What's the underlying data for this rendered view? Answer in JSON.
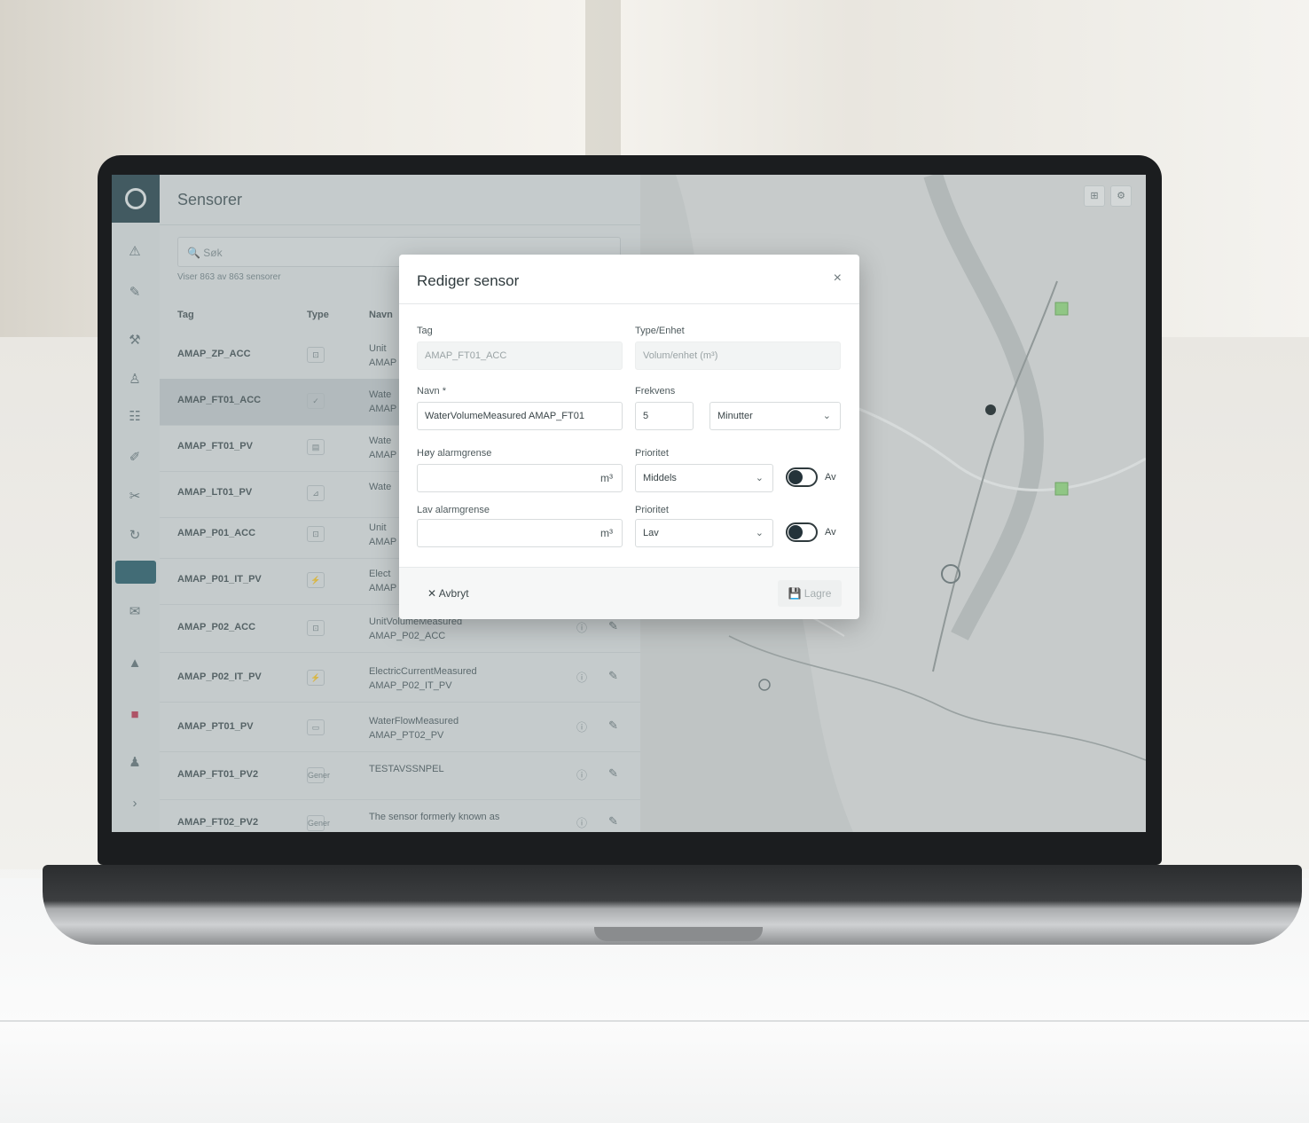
{
  "app": {
    "title": "Sensorer",
    "search_placeholder": "Søk",
    "count_text": "Viser 863 av 863 sensorer"
  },
  "table": {
    "headers": [
      "Tag",
      "Type",
      "Navn"
    ],
    "rows": [
      {
        "tag": "AMAP_ZP_ACC",
        "type": "⊡",
        "name": "Unit",
        "sub": "AMAP"
      },
      {
        "tag": "AMAP_FT01_ACC",
        "type": "✓",
        "name": "Wate",
        "sub": "AMAP"
      },
      {
        "tag": "AMAP_FT01_PV",
        "type": "▤",
        "name": "Wate",
        "sub": "AMAP"
      },
      {
        "tag": "AMAP_LT01_PV",
        "type": "⊿",
        "name": "Wate",
        "sub": ""
      },
      {
        "tag": "AMAP_P01_ACC",
        "type": "⊡",
        "name": "Unit",
        "sub": "AMAP"
      },
      {
        "tag": "AMAP_P01_IT_PV",
        "type": "⚡",
        "name": "Elect",
        "sub": "AMAP"
      },
      {
        "tag": "AMAP_P02_ACC",
        "type": "⊡",
        "name": "UnitVolumeMeasured",
        "sub": "AMAP_P02_ACC"
      },
      {
        "tag": "AMAP_P02_IT_PV",
        "type": "⚡",
        "name": "ElectricCurrentMeasured",
        "sub": "AMAP_P02_IT_PV"
      },
      {
        "tag": "AMAP_PT01_PV",
        "type": "▭",
        "name": "WaterFlowMeasured",
        "sub": "AMAP_PT02_PV"
      },
      {
        "tag": "AMAP_FT01_PV2",
        "type": "Gener",
        "name": "TESTAVSSNPEL",
        "sub": ""
      },
      {
        "tag": "AMAP_FT02_PV2",
        "type": "Gener",
        "name": "The sensor formerly known as",
        "sub": ""
      }
    ]
  },
  "modal": {
    "title": "Rediger sensor",
    "close": "×",
    "tag_label": "Tag",
    "tag_value": "AMAP_FT01_ACC",
    "type_label": "Type/Enhet",
    "type_value": "Volum/enhet (m³)",
    "name_label": "Navn *",
    "name_value": "WaterVolumeMeasured AMAP_FT01",
    "freq_label": "Frekvens",
    "freq_value": "5",
    "freq_unit": "Minutter",
    "high_label": "Høy alarmgrense",
    "high_unit": "m³",
    "high_priority_label": "Prioritet",
    "high_priority_value": "Middels",
    "high_toggle_label": "Av",
    "low_label": "Lav alarmgrense",
    "low_unit": "m³",
    "low_priority_label": "Prioritet",
    "low_priority_value": "Lav",
    "low_toggle_label": "Av",
    "cancel": "Avbryt",
    "save": "Lagre"
  },
  "map": {
    "controls": [
      "⊞",
      "⚙"
    ]
  },
  "colors": {
    "accent": "#2e4a52",
    "active": "#2e6370",
    "map_marker": "#8fcf7f"
  }
}
